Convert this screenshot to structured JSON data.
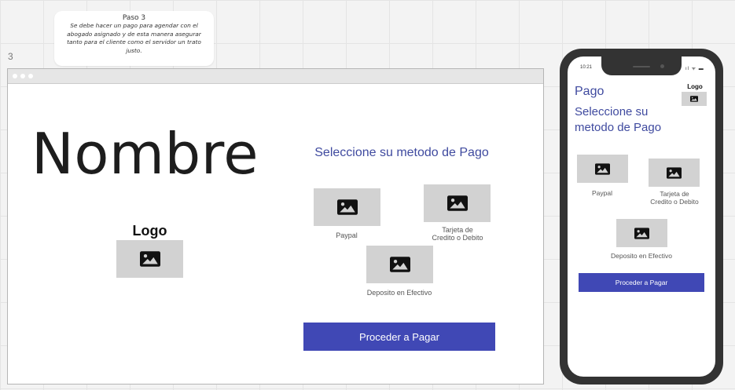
{
  "note": {
    "title": "Paso 3",
    "body": "Se debe hacer un pago para agendar con el abogado asignado y de esta manera asegurar tanto para el cliente como el servidor un trato justo."
  },
  "frame_number": "3",
  "desktop": {
    "title": "Nombre",
    "logo_label": "Logo",
    "heading": "Seleccione su metodo de Pago",
    "options": [
      {
        "label": "Paypal",
        "icon": "image-icon"
      },
      {
        "label": "Tarjeta de\nCredito o Debito",
        "icon": "image-icon"
      },
      {
        "label": "Deposito en Efectivo",
        "icon": "image-icon"
      }
    ],
    "proceed_button": "Proceder a Pagar"
  },
  "mobile": {
    "status_time": "10:21",
    "status_icons": "ıl ᯤ ▬",
    "title": "Pago",
    "logo_label": "Logo",
    "heading": "Seleccione su metodo de Pago",
    "options": [
      {
        "label": "Paypal",
        "icon": "image-icon"
      },
      {
        "label": "Tarjeta de\nCredito o Debito",
        "icon": "image-icon"
      },
      {
        "label": "Deposito en Efectivo",
        "icon": "image-icon"
      }
    ],
    "proceed_button": "Proceder a Pagar"
  },
  "colors": {
    "accent": "#4048b5",
    "heading": "#3f4a9f",
    "placeholder": "#d2d2d2",
    "phone_frame": "#333333"
  }
}
